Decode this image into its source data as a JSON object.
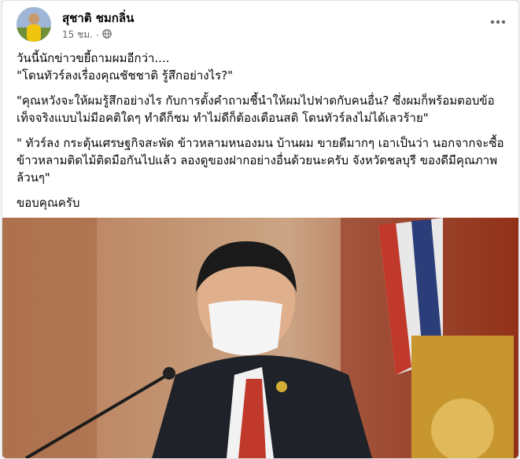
{
  "post": {
    "author": "สุชาติ ชมกลิ่น",
    "time": "15 ชม.",
    "separator": "·",
    "privacy_icon": "globe-icon",
    "more_icon": "more-options-icon",
    "paragraphs": [
      "วันนี้นักข่าวขยี้ถามผมอีกว่า....",
      "\"โดนทัวร์ลงเรื่องคุณชัชชาติ รู้สึกอย่างไร?\"",
      "\"คุณหวังจะให้ผมรู้สึกอย่างไร กับการตั้งคำถามชี้นำให้ผมไปฟาดกับคนอื่น? ซึ่งผมก็พร้อมตอบข้อเท็จจริงแบบไม่มีอคติใดๆ ทำดีก็ชม ทำไม่ดีก็ต้องเตือนสติ โดนทัวร์ลงไม่ได้เลวร้าย\"",
      "\" ทัวร์ลง กระตุ้นเศรษฐกิจสะพัด ข้าวหลามหนองมน บ้านผม ขายดีมากๆ  เอาเป็นว่า นอกจากจะซื้อข้าวหลามติดไม้ติดมือกันไปแล้ว  ลองดูของฝากอย่างอื่นด้วยนะครับ จังหวัดชลบุรี ของดีมีคุณภาพล้วนๆ\"",
      "ขอบคุณครับ"
    ]
  },
  "colors": {
    "card_bg": "#ffffff",
    "page_bg": "#f0f2f5",
    "text": "#050505",
    "meta_text": "#65676b"
  }
}
